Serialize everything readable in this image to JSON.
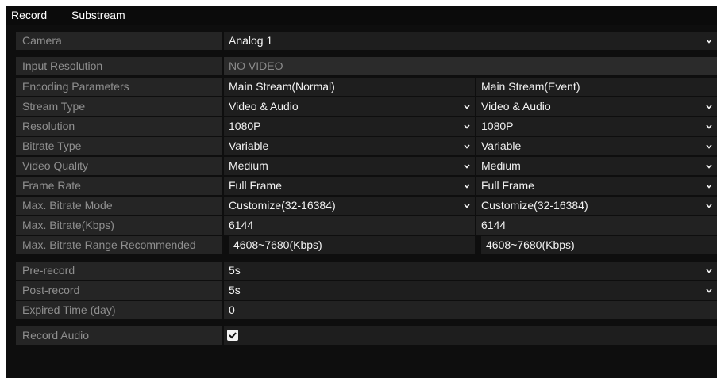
{
  "tabs": [
    {
      "label": "Record"
    },
    {
      "label": "Substream"
    }
  ],
  "camera": {
    "label": "Camera",
    "value": "Analog 1"
  },
  "input_resolution": {
    "label": "Input Resolution",
    "value": "NO VIDEO"
  },
  "encoding": {
    "label": "Encoding Parameters",
    "col1": "Main Stream(Normal)",
    "col2": "Main Stream(Event)"
  },
  "stream_type": {
    "label": "Stream Type",
    "col1": "Video & Audio",
    "col2": "Video & Audio"
  },
  "resolution": {
    "label": "Resolution",
    "col1": "1080P",
    "col2": "1080P"
  },
  "bitrate_type": {
    "label": "Bitrate Type",
    "col1": "Variable",
    "col2": "Variable"
  },
  "video_quality": {
    "label": "Video Quality",
    "col1": "Medium",
    "col2": "Medium"
  },
  "frame_rate": {
    "label": "Frame Rate",
    "col1": "Full Frame",
    "col2": "Full Frame"
  },
  "max_bitrate_mode": {
    "label": "Max. Bitrate Mode",
    "col1": "Customize(32-16384)",
    "col2": "Customize(32-16384)"
  },
  "max_bitrate": {
    "label": "Max. Bitrate(Kbps)",
    "col1": "6144",
    "col2": "6144"
  },
  "max_bitrate_range": {
    "label": "Max. Bitrate Range Recommended",
    "col1": "4608~7680(Kbps)",
    "col2": "4608~7680(Kbps)"
  },
  "pre_record": {
    "label": "Pre-record",
    "value": "5s"
  },
  "post_record": {
    "label": "Post-record",
    "value": "5s"
  },
  "expired_time": {
    "label": "Expired Time (day)",
    "value": "0"
  },
  "record_audio": {
    "label": "Record Audio",
    "checked": true
  },
  "colors": {
    "panel": "#0e0e0e",
    "label_bg": "#252525",
    "field_bg": "#1e1e1e",
    "label_text": "#8f8f8f",
    "value_text": "#f2f2f2"
  }
}
